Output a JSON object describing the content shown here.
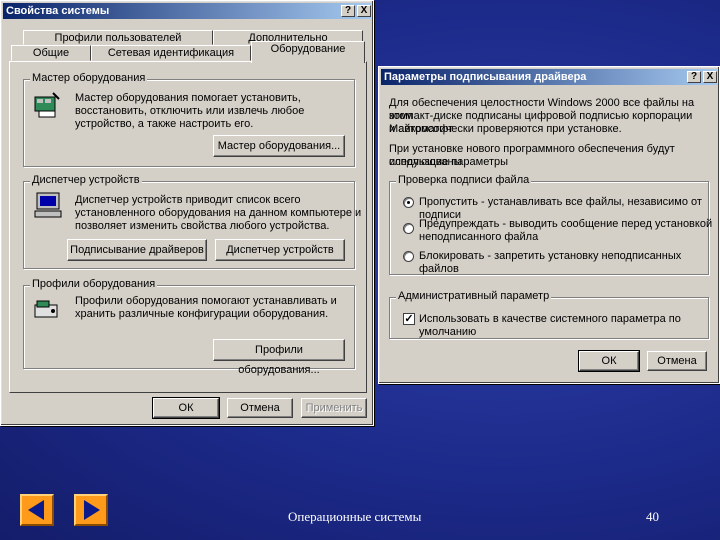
{
  "sysprops": {
    "title": "Свойства системы",
    "help_btn": "?",
    "close_btn": "X",
    "tabs_back": [
      "Профили пользователей",
      "Дополнительно"
    ],
    "tabs_front": [
      "Общие",
      "Сетевая идентификация",
      "Оборудование"
    ],
    "wizard": {
      "group_label": "Мастер оборудования",
      "line1": "Мастер оборудования помогает установить,",
      "line2": "восстановить, отключить или извлечь любое",
      "line3": "устройство, а также настроить его.",
      "button": "Мастер оборудования..."
    },
    "devmgr": {
      "group_label": "Диспетчер устройств",
      "line1": "Диспетчер устройств приводит список всего",
      "line2": "установленного оборудования на данном компьютере и",
      "line3": "позволяет изменить свойства любого устройства.",
      "button_signing": "Подписывание драйверов",
      "button_manager": "Диспетчер устройств"
    },
    "profiles": {
      "group_label": "Профили оборудования",
      "line1": "Профили оборудования помогают устанавливать и",
      "line2": "хранить различные конфигурации оборудования.",
      "button": "Профили оборудования..."
    },
    "ok": "ОК",
    "cancel": "Отмена",
    "apply": "Применить"
  },
  "signing": {
    "title": "Параметры подписывания драйвера",
    "help_btn": "?",
    "close_btn": "X",
    "intro1": "Для обеспечения целостности Windows 2000 все файлы на этом",
    "intro2": "компакт-диске подписаны цифровой подписью корпорации Майкрософт",
    "intro3": "и автоматически проверяются при установке.",
    "intro4": "При установке нового программного обеспечения будут использованы",
    "intro5": "следующие параметры",
    "check_group": "Проверка подписи файла",
    "opt1": "Пропустить - устанавливать все файлы, независимо от подписи",
    "opt2a": "Предупреждать - выводить сообщение перед установкой",
    "opt2b": "неподписанного файла",
    "opt3": "Блокировать - запретить установку неподписанных файлов",
    "admin_group": "Административный параметр",
    "admin_check": "Использовать в качестве системного параметра по умолчанию",
    "check_mark": "✓",
    "ok": "ОК",
    "cancel": "Отмена"
  },
  "footer": {
    "center_text": "Операционные системы",
    "page_number": "40"
  }
}
